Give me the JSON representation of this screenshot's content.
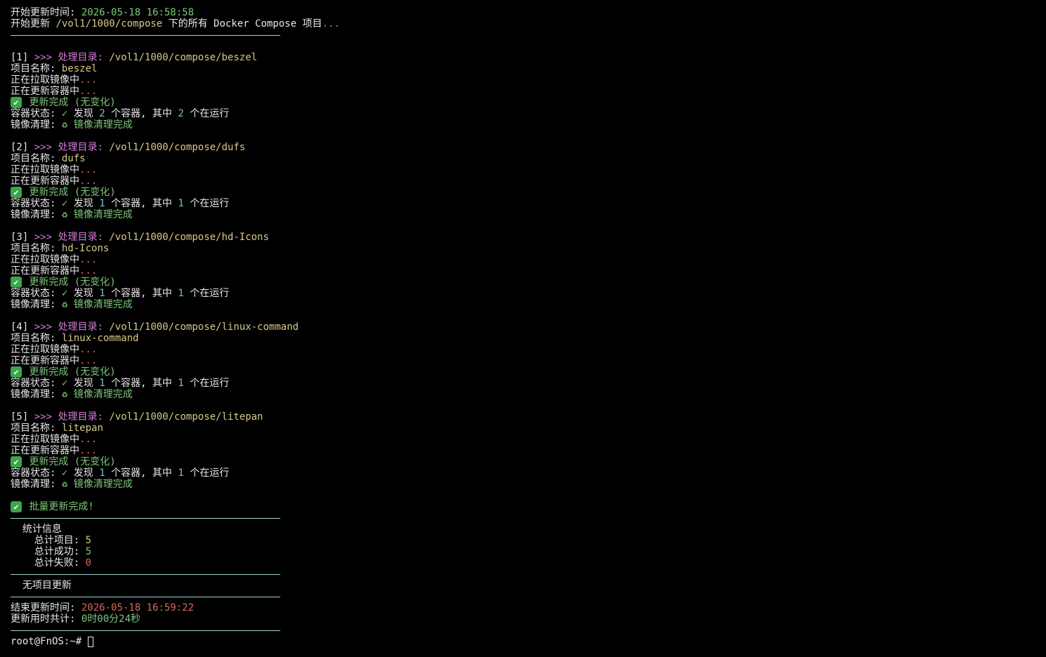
{
  "header": {
    "start_label": "开始更新时间:",
    "start_time": "2026-05-18 16:58:58",
    "intro_prefix": "开始更新",
    "intro_path": "/vol1/1000/compose",
    "intro_suffix": "下的所有 Docker Compose 项目",
    "ellipsis": "..."
  },
  "labels": {
    "process_dir": ">>> 处理目录:",
    "project_name": "项目名称:",
    "pulling": "正在拉取镜像中",
    "updating": "正在更新容器中",
    "done": "更新完成 (无变化)",
    "status": "容器状态:",
    "found": "发现",
    "containers_middle": "个容器, 其中",
    "running": "个在运行",
    "cleanup": "镜像清理:",
    "cleanup_done": "镜像清理完成",
    "checkmark": "✓",
    "recycle": "♻",
    "ellipsis": "..."
  },
  "projects": [
    {
      "index": "[1]",
      "path": "/vol1/1000/compose/beszel",
      "name": "beszel",
      "found": "2",
      "running": "2"
    },
    {
      "index": "[2]",
      "path": "/vol1/1000/compose/dufs",
      "name": "dufs",
      "found": "1",
      "running": "1"
    },
    {
      "index": "[3]",
      "path": "/vol1/1000/compose/hd-Icons",
      "name": "hd-Icons",
      "found": "1",
      "running": "1"
    },
    {
      "index": "[4]",
      "path": "/vol1/1000/compose/linux-command",
      "name": "linux-command",
      "found": "1",
      "running": "1"
    },
    {
      "index": "[5]",
      "path": "/vol1/1000/compose/litepan",
      "name": "litepan",
      "found": "1",
      "running": "1"
    }
  ],
  "summary": {
    "batch_done": "批量更新完成!",
    "stats_title": "统计信息",
    "total_projects_label": "总计项目:",
    "total_projects": "5",
    "total_success_label": "总计成功:",
    "total_success": "5",
    "total_fail_label": "总计失败:",
    "total_fail": "0",
    "no_updates": "无项目更新",
    "end_label": "结束更新时间:",
    "end_time": "2026-05-18 16:59:22",
    "duration_label": "更新用时共计:",
    "duration": "0时00分24秒"
  },
  "prompt": {
    "text": "root@FnOS:~#"
  },
  "colors": {
    "background": "#000000",
    "foreground": "#e8e8e8",
    "green": "#7ec87a",
    "yellow": "#d6c98a",
    "magenta": "#d57bd6",
    "cyan": "#6cc6d6",
    "red": "#d46a5e",
    "separator": "#9fd3d3"
  }
}
